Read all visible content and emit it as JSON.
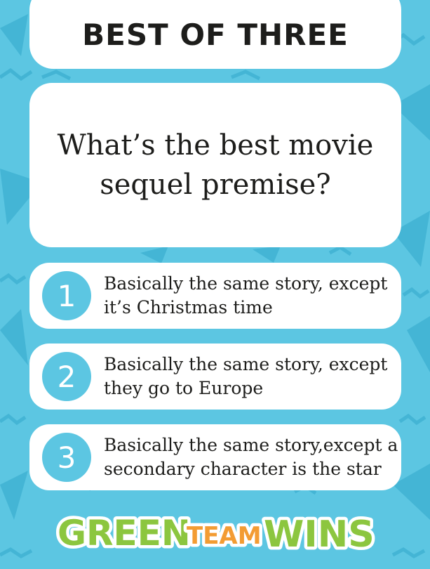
{
  "card": {
    "title": "BEST OF THREE",
    "question": "What’s the best movie sequel premise?",
    "options": [
      {
        "number": "1",
        "text": "Basically the same story, except it’s Christmas time"
      },
      {
        "number": "2",
        "text": "Basically the same story, except they go to Europe"
      },
      {
        "number": "3",
        "text": "Basically the same story,except a secondary character is the star"
      }
    ]
  },
  "logo": {
    "word1": "GREEN",
    "word2": "TEAM",
    "word3": "WINS"
  },
  "colors": {
    "background": "#5cc6e2",
    "accent": "#5cc6e2",
    "logo_green": "#8cc63f",
    "logo_orange": "#f39c33",
    "text": "#1d1d1b"
  }
}
